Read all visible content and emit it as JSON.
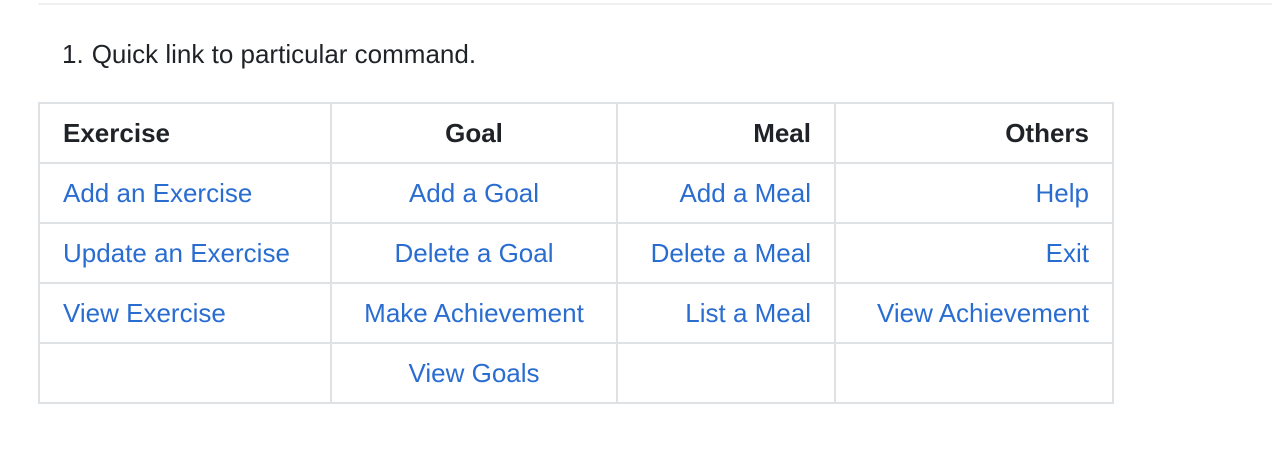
{
  "list": {
    "number": "1.",
    "text": "Quick link to particular command."
  },
  "table": {
    "headers": [
      "Exercise",
      "Goal",
      "Meal",
      "Others"
    ],
    "rows": [
      [
        "Add an Exercise",
        "Add a Goal",
        "Add a Meal",
        "Help"
      ],
      [
        "Update an Exercise",
        "Delete a Goal",
        "Delete a Meal",
        "Exit"
      ],
      [
        "View Exercise",
        "Make Achievement",
        "List a Meal",
        "View Achievement"
      ],
      [
        "",
        "View Goals",
        "",
        ""
      ]
    ]
  },
  "colors": {
    "link": "#2a6dd1",
    "border": "#dfe2e5",
    "text": "#1f2328"
  }
}
